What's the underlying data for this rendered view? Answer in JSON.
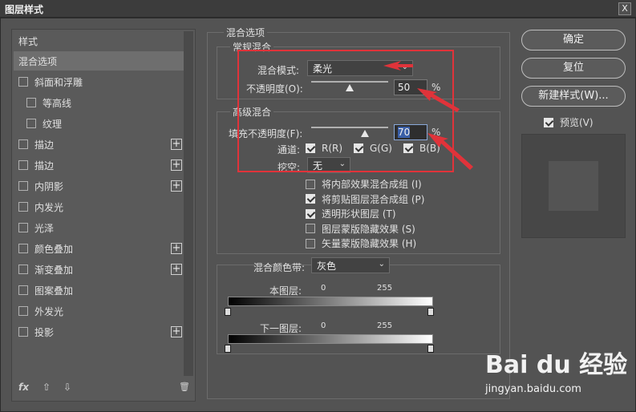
{
  "window": {
    "title": "图层样式",
    "close": "X"
  },
  "left_panel": {
    "header": "样式",
    "items": [
      {
        "label": "混合选项",
        "checkbox": false,
        "checked": false,
        "plus": false,
        "selected": true
      },
      {
        "label": "斜面和浮雕",
        "checkbox": true,
        "checked": false,
        "plus": false
      },
      {
        "label": "等高线",
        "checkbox": true,
        "checked": false,
        "plus": false,
        "indent": true
      },
      {
        "label": "纹理",
        "checkbox": true,
        "checked": false,
        "plus": false,
        "indent": true
      },
      {
        "label": "描边",
        "checkbox": true,
        "checked": false,
        "plus": true
      },
      {
        "label": "描边",
        "checkbox": true,
        "checked": false,
        "plus": true
      },
      {
        "label": "内阴影",
        "checkbox": true,
        "checked": false,
        "plus": true
      },
      {
        "label": "内发光",
        "checkbox": true,
        "checked": false,
        "plus": false
      },
      {
        "label": "光泽",
        "checkbox": true,
        "checked": false,
        "plus": false
      },
      {
        "label": "颜色叠加",
        "checkbox": true,
        "checked": false,
        "plus": true
      },
      {
        "label": "渐变叠加",
        "checkbox": true,
        "checked": false,
        "plus": true
      },
      {
        "label": "图案叠加",
        "checkbox": true,
        "checked": false,
        "plus": false
      },
      {
        "label": "外发光",
        "checkbox": true,
        "checked": false,
        "plus": false
      },
      {
        "label": "投影",
        "checkbox": true,
        "checked": false,
        "plus": true
      }
    ],
    "footer": {
      "fx": "fx",
      "up": "⇧",
      "down": "⇩",
      "trash": "🗑"
    },
    "plus_symbol": "+"
  },
  "blend": {
    "section_title": "混合选项",
    "normal": {
      "title": "常规混合",
      "mode_label": "混合模式:",
      "mode_value": "柔光",
      "opacity_label": "不透明度(O):",
      "opacity_value": "50",
      "opacity_pct": 0.5,
      "pct": "%"
    },
    "advanced": {
      "title": "高级混合",
      "fill_label": "填充不透明度(F):",
      "fill_value": "70",
      "fill_pct": 0.7,
      "pct": "%",
      "channels_label": "通道:",
      "ch_r": "R(R)",
      "ch_g": "G(G)",
      "ch_b": "B(B)",
      "knockout_label": "挖空:",
      "knockout_value": "无",
      "options": [
        {
          "label": "将内部效果混合成组 (I)",
          "checked": false
        },
        {
          "label": "将剪贴图层混合成组 (P)",
          "checked": true
        },
        {
          "label": "透明形状图层 (T)",
          "checked": true
        },
        {
          "label": "图层蒙版隐藏效果 (S)",
          "checked": false
        },
        {
          "label": "矢量蒙版隐藏效果 (H)",
          "checked": false
        }
      ]
    },
    "blend_if": {
      "label": "混合颜色带:",
      "value": "灰色",
      "this_layer": "本图层:",
      "underlying": "下一图层:",
      "min": "0",
      "max": "255"
    }
  },
  "buttons": {
    "ok": "确定",
    "reset": "复位",
    "new_style": "新建样式(W)...",
    "preview": "预览(V)"
  },
  "watermark": {
    "logo": "Bai du 经验",
    "url": "jingyan.baidu.com"
  },
  "colors": {
    "annotation": "#e0333a",
    "focus": "#3a5fa8"
  }
}
